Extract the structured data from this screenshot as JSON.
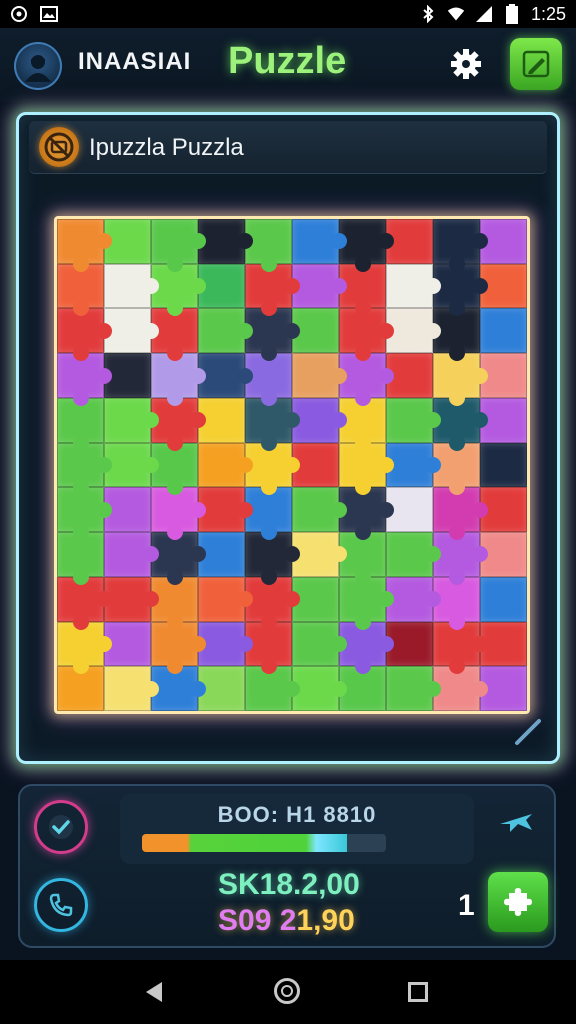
{
  "status_bar": {
    "time": "1:25",
    "icons": [
      "sync-icon",
      "gallery-icon",
      "bluetooth-icon",
      "wifi-icon",
      "signal-icon",
      "battery-icon"
    ]
  },
  "header": {
    "username": "INAASIAI",
    "app_title": "Puzzle",
    "icons": [
      "avatar",
      "gear-icon",
      "edit-icon"
    ]
  },
  "board": {
    "title": "Ipuzzla Puzzla",
    "icon": "no-camera-icon",
    "rows": 11,
    "cols": 10,
    "tiles": [
      "#f08a30",
      "#6bd94a",
      "#58c84b",
      "#1c2230",
      "#5ac84a",
      "#2e7fd8",
      "#1c2230",
      "#e23b3b",
      "#1c2a44",
      "#b45ae0",
      "#f0603a",
      "#efefe7",
      "#6bd94a",
      "#3ab85a",
      "#e23b3b",
      "#b45ae0",
      "#e23b3b",
      "#efefe7",
      "#1c2a44",
      "#f0603a",
      "#e23b3b",
      "#efefe7",
      "#e23b3b",
      "#5ac84a",
      "#2b3650",
      "#5ac84a",
      "#e23b3b",
      "#efe8dd",
      "#1c2230",
      "#2e7fd8",
      "#b45ae0",
      "#222838",
      "#b19ae8",
      "#2b4a7a",
      "#8a6ae0",
      "#e8a060",
      "#b45ae0",
      "#e23b3b",
      "#f5d05a",
      "#f08a8a",
      "#5ac84a",
      "#6bd94a",
      "#e23b3b",
      "#f5d030",
      "#2f5868",
      "#8a5ae0",
      "#f5d030",
      "#5ac84a",
      "#1f5a6a",
      "#b45ae0",
      "#5ac84a",
      "#6bd94a",
      "#58c84b",
      "#f5a020",
      "#f5d030",
      "#e23b3b",
      "#f5d030",
      "#2e7fd8",
      "#f2a070",
      "#1c2a44",
      "#5ac84a",
      "#b45ae0",
      "#d85ae0",
      "#e23b3b",
      "#2e7fd8",
      "#5ac84a",
      "#2b3650",
      "#e8e4f0",
      "#d23cb0",
      "#e23b3b",
      "#5ac84a",
      "#b45ae0",
      "#2b3650",
      "#2e7fd8",
      "#222838",
      "#f5e070",
      "#5ac84a",
      "#5ac84a",
      "#b45ae0",
      "#f08a8a",
      "#e23b3b",
      "#e23b3b",
      "#f08a30",
      "#f0603a",
      "#e23b3b",
      "#5ac84a",
      "#5ac84a",
      "#b45ae0",
      "#d85ae0",
      "#2e7fd8",
      "#f5d030",
      "#b45ae0",
      "#f08a30",
      "#8a5ae0",
      "#e23b3b",
      "#5ac84a",
      "#8a5ae0",
      "#9a1a2a",
      "#e23b3b",
      "#e23b3b",
      "#f5a020",
      "#f5e070",
      "#2e7fd8",
      "#8ad85a",
      "#5ac84a",
      "#6bd94a",
      "#58c84b",
      "#5ac84a",
      "#f08a8a",
      "#b45ae0"
    ],
    "resize_icon": "resize-handle-icon"
  },
  "panel": {
    "progress_label": "BOO: H1 8810",
    "progress_value": 0.84,
    "check_icon": "check-icon",
    "plane_icon": "plane-icon",
    "phone_icon": "phone-icon",
    "score_top": "SK18.2,00",
    "score_bottom_a": "S09 2",
    "score_bottom_b": "1,90",
    "count": "1",
    "add_icon": "puzzle-add-icon"
  },
  "nav": {
    "back_icon": "back-icon",
    "home_icon": "home-icon",
    "recent_icon": "recent-apps-icon"
  }
}
